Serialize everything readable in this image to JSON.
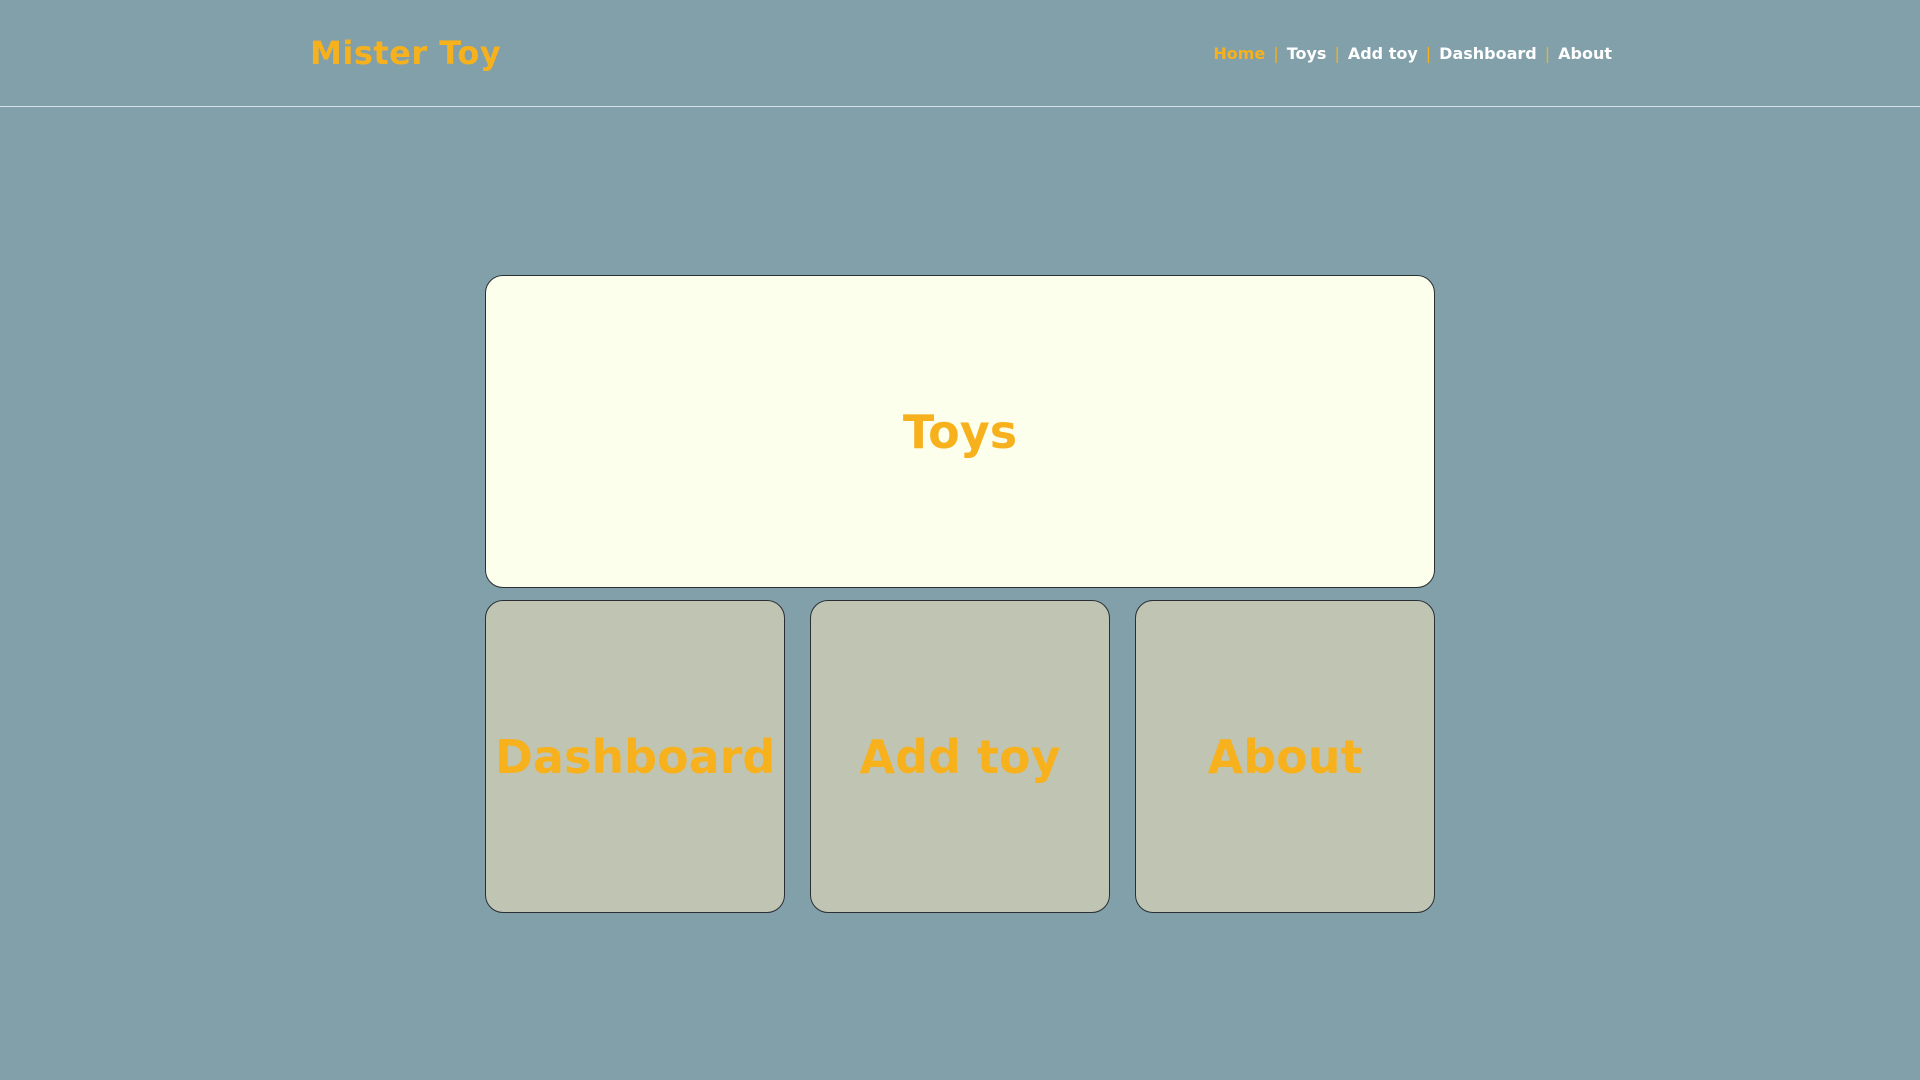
{
  "header": {
    "logo": "Mister Toy",
    "nav": [
      {
        "label": "Home",
        "active": true
      },
      {
        "label": "Toys",
        "active": false
      },
      {
        "label": "Add toy",
        "active": false
      },
      {
        "label": "Dashboard",
        "active": false
      },
      {
        "label": "About",
        "active": false
      }
    ],
    "separator": "|"
  },
  "tiles": {
    "main": {
      "label": "Toys"
    },
    "dashboard": {
      "label": "Dashboard"
    },
    "add_toy": {
      "label": "Add toy"
    },
    "about": {
      "label": "About"
    }
  },
  "colors": {
    "background": "#81a0aa",
    "accent": "#f7b11d",
    "tile_main_bg": "#fbffeb",
    "tile_small_bg": "#c0c4b3"
  }
}
